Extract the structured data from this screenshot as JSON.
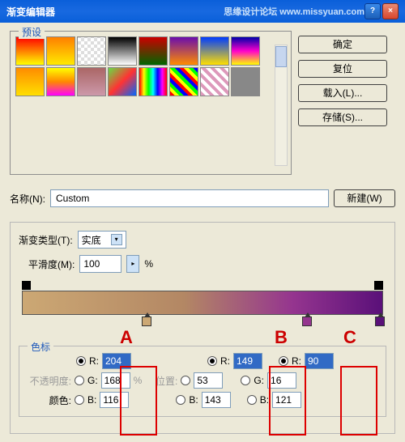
{
  "window": {
    "title": "渐变编辑器"
  },
  "preset": {
    "legend": "预设"
  },
  "buttons": {
    "ok": "确定",
    "reset": "复位",
    "load": "载入(L)...",
    "save": "存储(S)...",
    "new": "新建(W)"
  },
  "name": {
    "label": "名称(N):",
    "value": "Custom"
  },
  "gradient": {
    "type_label": "渐变类型(T):",
    "type_value": "实底",
    "smooth_label": "平滑度(M):",
    "smooth_value": "100",
    "smooth_unit": "%"
  },
  "markers": {
    "a": "A",
    "b": "B",
    "c": "C"
  },
  "stops": {
    "legend": "色标",
    "opacity_label": "不透明度:",
    "position_label": "位置:",
    "color_label": "颜色:",
    "r_label": "R:",
    "g_label": "G:",
    "b_label": "B:",
    "pct": "%",
    "a": {
      "r": "204",
      "g": "168",
      "b": "116"
    },
    "b": {
      "r": "149",
      "g": "53",
      "b": "143"
    },
    "c": {
      "r": "90",
      "g": "16",
      "b": "121"
    }
  },
  "watermark": "思缘设计论坛  www.missyuan.com",
  "swatches": [
    "linear-gradient(to bottom,#ff0000,#ffff00)",
    "linear-gradient(to bottom,#ff7f00,#ffea00)",
    "repeating-conic-gradient(#fff 0 25%,#ddd 0 50%) 0/8px 8px",
    "linear-gradient(to bottom,#000,#fff)",
    "linear-gradient(to bottom,#c00,#060)",
    "linear-gradient(to bottom,#6a0dad,#ff8c00)",
    "linear-gradient(to bottom,#003cff,#ffdf00)",
    "linear-gradient(to bottom,#00a,#f0c,#ff0)",
    "linear-gradient(to bottom,#ff8c00,#ffdf00)",
    "linear-gradient(to bottom,#ff0,#f80,#f0f)",
    "linear-gradient(to bottom,#a66,#c9a)",
    "linear-gradient(135deg,#6d4,#f33,#06f)",
    "linear-gradient(to right,#f00,#ff0,#0f0,#0ff,#00f,#f0f,#f00)",
    "repeating-linear-gradient(45deg,#f00 0 4px,#ff0 4px 8px,#0f0 8px 12px,#00f 12px 16px)",
    "repeating-linear-gradient(45deg,#d9b 0 4px,#fff 4px 8px)",
    "linear-gradient(to bottom,#888,#888)"
  ]
}
